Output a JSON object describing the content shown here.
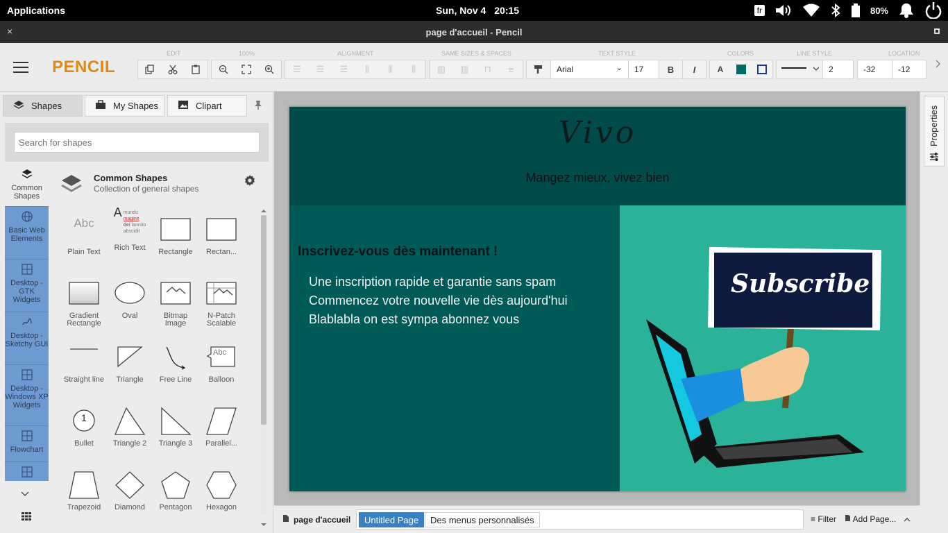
{
  "system_bar": {
    "applications": "Applications",
    "date": "Sun, Nov  4",
    "time": "20:15",
    "keyboard_layout": "fr",
    "battery": "80%",
    "icons": [
      "volume-icon",
      "wifi-icon",
      "bluetooth-icon",
      "battery-icon",
      "notification-bell-icon",
      "power-icon"
    ]
  },
  "window": {
    "title": "page d'accueil - Pencil",
    "close": "×"
  },
  "toolbar": {
    "logo": "PENCIL",
    "groups": {
      "edit": "EDIT",
      "zoom": "100%",
      "alignment": "ALIGNMENT",
      "same_sizes": "SAME SIZES & SPACES",
      "text_style": "TEXT STYLE",
      "colors": "COLORS",
      "line_style": "LINE STYLE",
      "location": "LOCATION"
    },
    "font_name": "Arial",
    "font_size": "17",
    "bold": "B",
    "italic": "I",
    "text_color_label": "A",
    "fill_color": "#006b66",
    "stroke_color": "#1a3a8a",
    "line_width": "2",
    "location_x": "-32",
    "location_y": "-12"
  },
  "left_panel": {
    "tabs": [
      "Shapes",
      "My Shapes",
      "Clipart"
    ],
    "search_placeholder": "Search for shapes",
    "categories": [
      "Common Shapes",
      "Basic Web Elements",
      "Desktop - GTK Widgets",
      "Desktop - Sketchy GUI",
      "Desktop - Windows XP Widgets",
      "Flowchart"
    ],
    "collection": {
      "title": "Common Shapes",
      "subtitle": "Collection of general shapes"
    },
    "shapes": [
      "Plain Text",
      "Rich Text",
      "Rectangle",
      "Rectan...",
      "Gradient Rectangle",
      "Oval",
      "Bitmap Image",
      "N-Patch Scalable",
      "Straight line",
      "Triangle",
      "Free Line",
      "Balloon",
      "Bullet",
      "Triangle 2",
      "Triangle 3",
      "Parallel...",
      "Trapezoid",
      "Diamond",
      "Pentagon",
      "Hexagon"
    ],
    "plain_text_sample": "Abc",
    "rich_text_sample": {
      "big": "A",
      "words": [
        "mundu",
        "magine",
        "dei",
        "lannito",
        "abscidit"
      ]
    },
    "balloon_sample": "Abc",
    "bullet_sample": "1"
  },
  "canvas": {
    "brand": "Vivo",
    "tagline": "Mangez mieux, vivez bien",
    "headline": "Inscrivez-vous dès maintenant !",
    "bullets": [
      "Une inscription rapide et garantie sans spam",
      "Commencez votre nouvelle vie dès aujourd'hui",
      "Blablabla on est sympa abonnez vous"
    ],
    "sign_text": "Subscribe",
    "colors": {
      "header_bg": "#014b4a",
      "left_bg": "#005a57",
      "right_bg": "#2bb39a",
      "sign_bg": "#0e1a3e"
    }
  },
  "properties": {
    "label": "Properties"
  },
  "page_bar": {
    "current_page": "page d'accueil",
    "tabs": [
      "Untitled Page",
      "Des menus personnalisés"
    ],
    "filter": "Filter",
    "add_page": "Add Page..."
  }
}
